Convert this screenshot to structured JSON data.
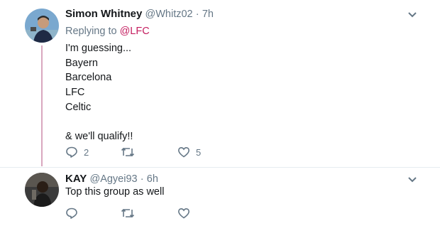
{
  "tweets": [
    {
      "name": "Simon Whitney",
      "handle": "@Whitz02",
      "dot": "·",
      "time": "7h",
      "replying_prefix": "Replying to",
      "replying_handle": "@LFC",
      "text": "I'm guessing...\nBayern\nBarcelona\nLFC\nCeltic\n\n& we'll qualify!!",
      "reply_count": "2",
      "retweet_count": "",
      "like_count": "5"
    },
    {
      "name": "KAY",
      "handle": "@Agyei93",
      "dot": "·",
      "time": "6h",
      "text": "Top this group as well",
      "reply_count": "",
      "retweet_count": "",
      "like_count": ""
    }
  ],
  "icons": {
    "reply": "reply-icon",
    "retweet": "retweet-icon",
    "like": "heart-icon",
    "menu": "chevron-down-icon"
  },
  "colors": {
    "thread_line": "#d9a7bf",
    "mention": "#c41d5f",
    "muted": "#657786"
  }
}
